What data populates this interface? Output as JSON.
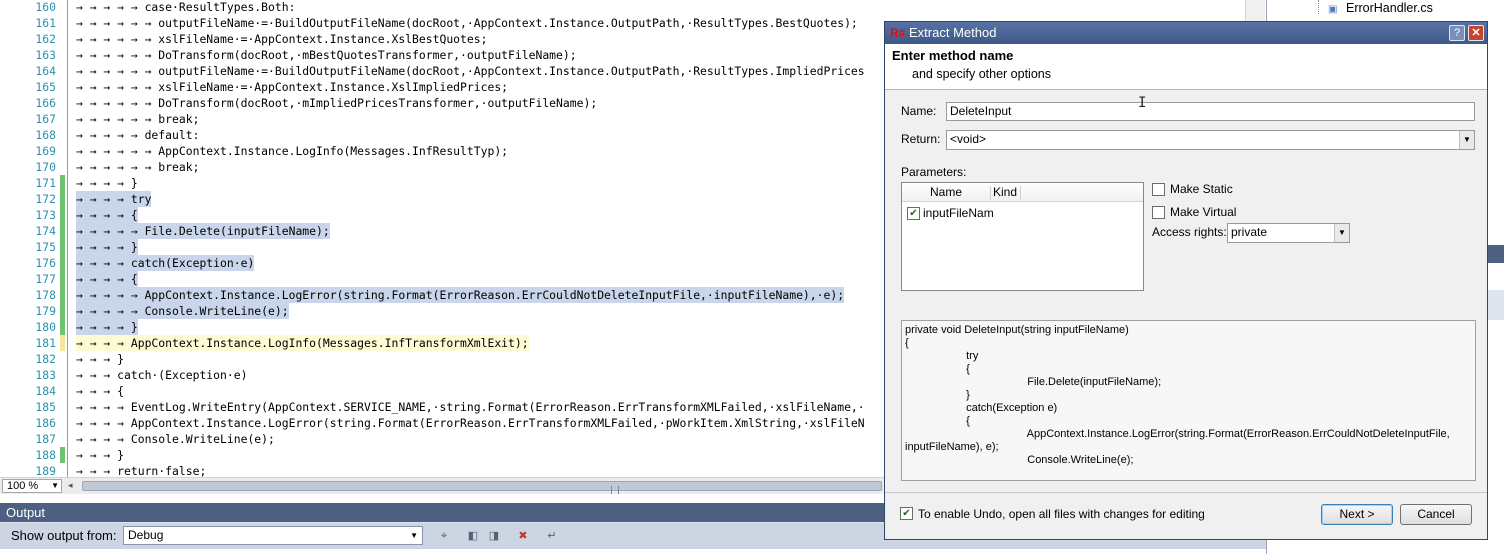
{
  "editor": {
    "lines": [
      {
        "n": "160",
        "text": "→ → → → → case·ResultTypes.Both:",
        "sel": false,
        "chg": ""
      },
      {
        "n": "161",
        "text": "→ → → → → → outputFileName·=·BuildOutputFileName(docRoot,·AppContext.Instance.OutputPath,·ResultTypes.BestQuotes);",
        "sel": false,
        "chg": ""
      },
      {
        "n": "162",
        "text": "→ → → → → → xslFileName·=·AppContext.Instance.XslBestQuotes;",
        "sel": false,
        "chg": ""
      },
      {
        "n": "163",
        "text": "→ → → → → → DoTransform(docRoot,·mBestQuotesTransformer,·outputFileName);",
        "sel": false,
        "chg": ""
      },
      {
        "n": "164",
        "text": "→ → → → → → outputFileName·=·BuildOutputFileName(docRoot,·AppContext.Instance.OutputPath,·ResultTypes.ImpliedPrices",
        "sel": false,
        "chg": ""
      },
      {
        "n": "165",
        "text": "→ → → → → → xslFileName·=·AppContext.Instance.XslImpliedPrices;",
        "sel": false,
        "chg": ""
      },
      {
        "n": "166",
        "text": "→ → → → → → DoTransform(docRoot,·mImpliedPricesTransformer,·outputFileName);",
        "sel": false,
        "chg": ""
      },
      {
        "n": "167",
        "text": "→ → → → → → break;",
        "sel": false,
        "chg": ""
      },
      {
        "n": "168",
        "text": "→ → → → → default:",
        "sel": false,
        "chg": ""
      },
      {
        "n": "169",
        "text": "→ → → → → → AppContext.Instance.LogInfo(Messages.InfResultTyp);",
        "sel": false,
        "chg": ""
      },
      {
        "n": "170",
        "text": "→ → → → → → break;",
        "sel": false,
        "chg": ""
      },
      {
        "n": "171",
        "text": "→ → → → }",
        "sel": false,
        "chg": "g"
      },
      {
        "n": "172",
        "text": "→ → → → try",
        "sel": true,
        "chg": "g"
      },
      {
        "n": "173",
        "text": "→ → → → {",
        "sel": true,
        "chg": "g"
      },
      {
        "n": "174",
        "text": "→ → → → → File.Delete(inputFileName);",
        "sel": true,
        "chg": "g"
      },
      {
        "n": "175",
        "text": "→ → → → }",
        "sel": true,
        "chg": "g"
      },
      {
        "n": "176",
        "text": "→ → → → catch(Exception·e)",
        "sel": true,
        "chg": "g"
      },
      {
        "n": "177",
        "text": "→ → → → {",
        "sel": true,
        "chg": "g"
      },
      {
        "n": "178",
        "text": "→ → → → → AppContext.Instance.LogError(string.Format(ErrorReason.ErrCouldNotDeleteInputFile,·inputFileName),·e);",
        "sel": true,
        "chg": "g"
      },
      {
        "n": "179",
        "text": "→ → → → → Console.WriteLine(e);",
        "sel": true,
        "chg": "g"
      },
      {
        "n": "180",
        "text": "→ → → → }",
        "sel": true,
        "chg": "g"
      },
      {
        "n": "181",
        "text": "→ → → → AppContext.Instance.LogInfo(Messages.InfTransformXmlExit);",
        "sel": false,
        "chg": "y",
        "cur": true
      },
      {
        "n": "182",
        "text": "→ → → }",
        "sel": false,
        "chg": ""
      },
      {
        "n": "183",
        "text": "→ → → catch·(Exception·e)",
        "sel": false,
        "chg": ""
      },
      {
        "n": "184",
        "text": "→ → → {",
        "sel": false,
        "chg": ""
      },
      {
        "n": "185",
        "text": "→ → → → EventLog.WriteEntry(AppContext.SERVICE_NAME,·string.Format(ErrorReason.ErrTransformXMLFailed,·xslFileName,·",
        "sel": false,
        "chg": ""
      },
      {
        "n": "186",
        "text": "→ → → → AppContext.Instance.LogError(string.Format(ErrorReason.ErrTransformXMLFailed,·pWorkItem.XmlString,·xslFileN",
        "sel": false,
        "chg": ""
      },
      {
        "n": "187",
        "text": "→ → → → Console.WriteLine(e);",
        "sel": false,
        "chg": ""
      },
      {
        "n": "188",
        "text": "→ → → }",
        "sel": false,
        "chg": "g"
      },
      {
        "n": "189",
        "text": "→ → → return·false;",
        "sel": false,
        "chg": ""
      }
    ],
    "zoom": "100 %"
  },
  "output": {
    "title": "Output",
    "show_label": "Show output from:",
    "source": "Debug"
  },
  "solution": {
    "file": "ErrorHandler.cs"
  },
  "dialog": {
    "title": "Extract Method",
    "help": "?",
    "close": "✕",
    "heading": "Enter method name",
    "subheading": "and specify other options",
    "name_label": "Name:",
    "name_value": "DeleteInput",
    "return_label": "Return:",
    "return_value": "<void>",
    "parameters_label": "Parameters:",
    "col_name": "Name",
    "col_kind": "Kind",
    "param_1": "inputFileNam",
    "make_static": "Make Static",
    "make_virtual": "Make Virtual",
    "access_label": "Access rights:",
    "access_value": "private",
    "preview": [
      "private void DeleteInput(string inputFileName)",
      "{",
      "                    try",
      "                    {",
      "                                        File.Delete(inputFileName);",
      "                    }",
      "                    catch(Exception e)",
      "                    {",
      "                                        AppContext.Instance.LogError(string.Format(ErrorReason.ErrCouldNotDeleteInputFile,",
      "inputFileName), e);",
      "                                        Console.WriteLine(e);"
    ],
    "undo_label": "To enable Undo, open all files with changes for editing",
    "next": "Next >",
    "cancel": "Cancel"
  }
}
